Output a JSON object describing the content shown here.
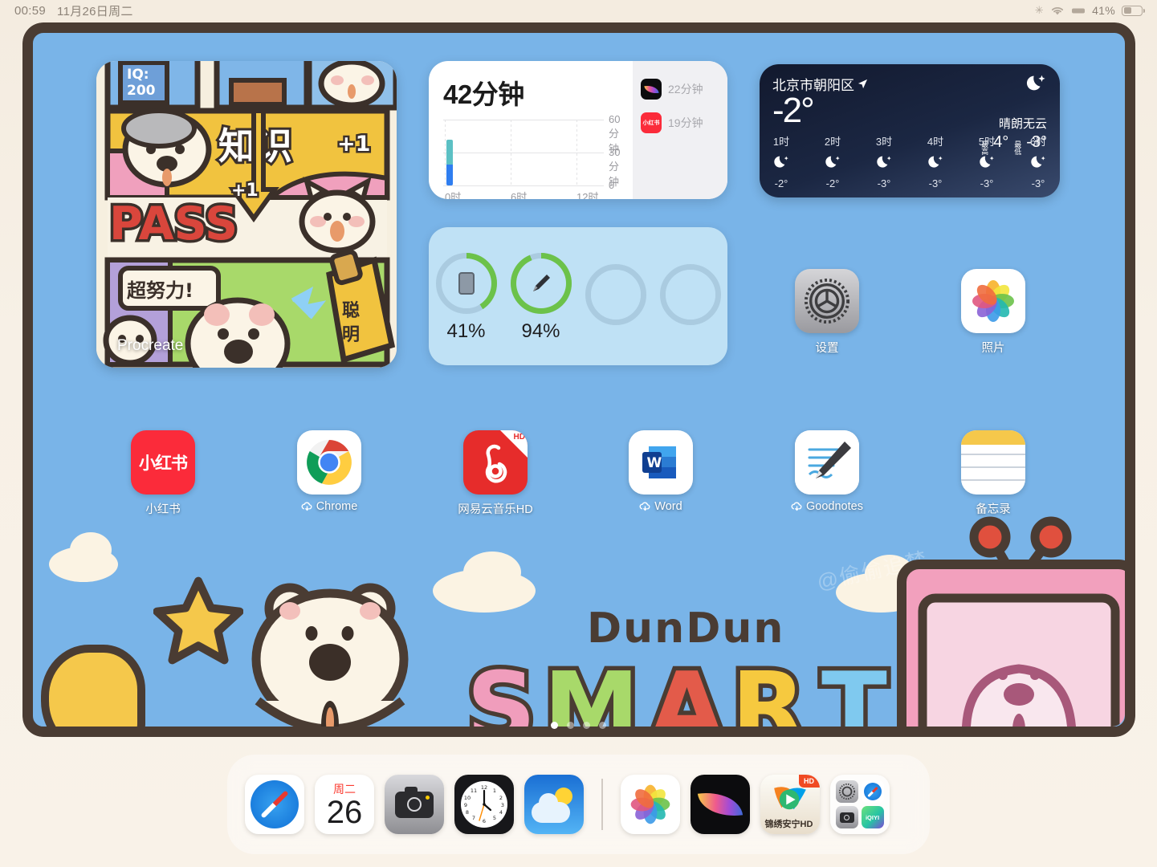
{
  "status_bar": {
    "time": "00:59",
    "date": "11月26日周二",
    "battery_percent": "41%",
    "icons": [
      "rotation-lock-icon",
      "wifi-icon",
      "keyboard-icon",
      "battery-icon"
    ]
  },
  "widgets": {
    "procreate": {
      "label": "Procreate"
    },
    "screen_time": {
      "total": "42分钟",
      "y_labels": [
        "60分钟",
        "30分钟",
        "0"
      ],
      "x_labels": [
        "0时",
        "6时",
        "12时"
      ],
      "apps": [
        {
          "name": "Procreate",
          "minutes": "22分钟",
          "icon": "procreate-icon"
        },
        {
          "name": "小红书",
          "minutes": "19分钟",
          "icon": "xiaohongshu-icon"
        }
      ]
    },
    "weather": {
      "city": "北京市朝阳区",
      "current_temp": "-2°",
      "condition": "晴朗无云",
      "high_label": "最高",
      "high": "4°",
      "low_label": "最低",
      "low": "-3°",
      "hours": [
        {
          "time": "1时",
          "temp": "-2°"
        },
        {
          "time": "2时",
          "temp": "-2°"
        },
        {
          "time": "3时",
          "temp": "-3°"
        },
        {
          "time": "4时",
          "temp": "-3°"
        },
        {
          "time": "5时",
          "temp": "-3°"
        },
        {
          "time": "6时",
          "temp": "-3°"
        }
      ]
    },
    "batteries": [
      {
        "device": "ipad",
        "percent": "41%",
        "value": 41
      },
      {
        "device": "apple-pencil",
        "percent": "94%",
        "value": 94
      },
      {
        "device": "empty",
        "percent": "",
        "value": 0
      },
      {
        "device": "empty",
        "percent": "",
        "value": 0
      }
    ]
  },
  "home_apps": [
    {
      "name": "设置",
      "icon": "settings-icon",
      "downloading": false
    },
    {
      "name": "照片",
      "icon": "photos-icon",
      "downloading": false
    },
    {
      "name": "小红书",
      "icon": "xiaohongshu-icon",
      "downloading": false
    },
    {
      "name": "Chrome",
      "icon": "chrome-icon",
      "downloading": true
    },
    {
      "name": "网易云音乐HD",
      "icon": "netease-music-icon",
      "downloading": false
    },
    {
      "name": "Word",
      "icon": "word-icon",
      "downloading": true
    },
    {
      "name": "Goodnotes",
      "icon": "goodnotes-icon",
      "downloading": true
    },
    {
      "name": "备忘录",
      "icon": "notes-icon",
      "downloading": false
    }
  ],
  "page_dots": {
    "count": 4,
    "active_index": 0
  },
  "dock": {
    "apps": [
      {
        "name": "Safari",
        "icon": "safari-icon"
      },
      {
        "name": "日历",
        "icon": "calendar-icon",
        "day": "26",
        "weekday": "周二"
      },
      {
        "name": "相机",
        "icon": "camera-icon"
      },
      {
        "name": "时钟",
        "icon": "clock-icon"
      },
      {
        "name": "天气",
        "icon": "weather-icon"
      }
    ],
    "recents": [
      {
        "name": "照片",
        "icon": "photos-icon"
      },
      {
        "name": "Procreate",
        "icon": "procreate-icon"
      },
      {
        "name": "锦绣安宁HD",
        "icon": "tencent-video-icon",
        "badge": "HD"
      },
      {
        "name": "App资源库文件夹",
        "icon": "folder-icon"
      }
    ]
  },
  "wallpaper": {
    "title_script": "DunDun",
    "title_letters": [
      "S",
      "M",
      "A",
      "R",
      "T"
    ],
    "letter_colors": [
      "#f09dbc",
      "#a8d96a",
      "#e35b4a",
      "#f6c93f",
      "#7fc9ef"
    ],
    "watermark": "@偷偷追梦",
    "background_color": "#79b4e8",
    "border_color": "#4a3c33"
  },
  "colors": {
    "accent_green": "#6cc24a",
    "widget_blue": "#bfe1f5",
    "dock_bg": "rgba(255,255,255,0.42)"
  }
}
